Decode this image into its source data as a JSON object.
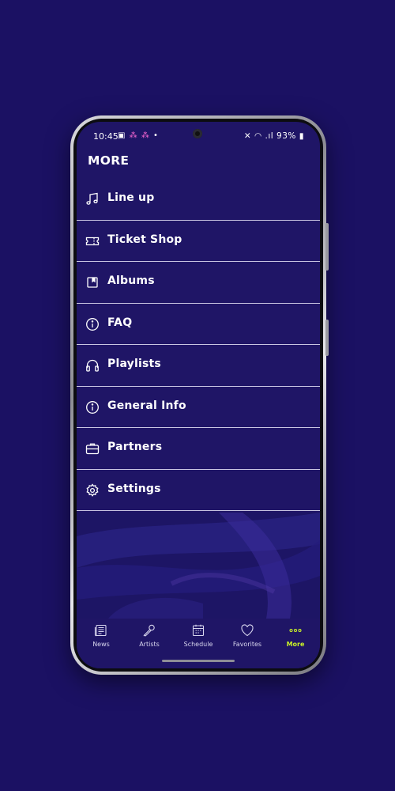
{
  "status_bar": {
    "time": "10:45",
    "notifications": "▣ ⁂ ⁂ •",
    "right": "🔇 ◠ ▮ 93%▮",
    "battery": "93%"
  },
  "page": {
    "title": "MORE"
  },
  "menu": {
    "items": [
      {
        "label": "Line up",
        "icon": "music-note-icon"
      },
      {
        "label": "Ticket Shop",
        "icon": "ticket-icon"
      },
      {
        "label": "Albums",
        "icon": "album-icon"
      },
      {
        "label": "FAQ",
        "icon": "info-icon"
      },
      {
        "label": "Playlists",
        "icon": "headphones-icon"
      },
      {
        "label": "General Info",
        "icon": "info-icon"
      },
      {
        "label": "Partners",
        "icon": "briefcase-icon"
      },
      {
        "label": "Settings",
        "icon": "gear-icon"
      }
    ]
  },
  "bottom_nav": {
    "items": [
      {
        "label": "News",
        "icon": "newspaper-icon"
      },
      {
        "label": "Artists",
        "icon": "microphone-icon"
      },
      {
        "label": "Schedule",
        "icon": "calendar-icon"
      },
      {
        "label": "Favorites",
        "icon": "heart-icon"
      },
      {
        "label": "More",
        "icon": "more-dots-icon",
        "active": true
      }
    ]
  },
  "colors": {
    "background": "#1b1163",
    "screen": "#1f1566",
    "divider": "#c9c5e2",
    "accent": "#c9f227"
  }
}
